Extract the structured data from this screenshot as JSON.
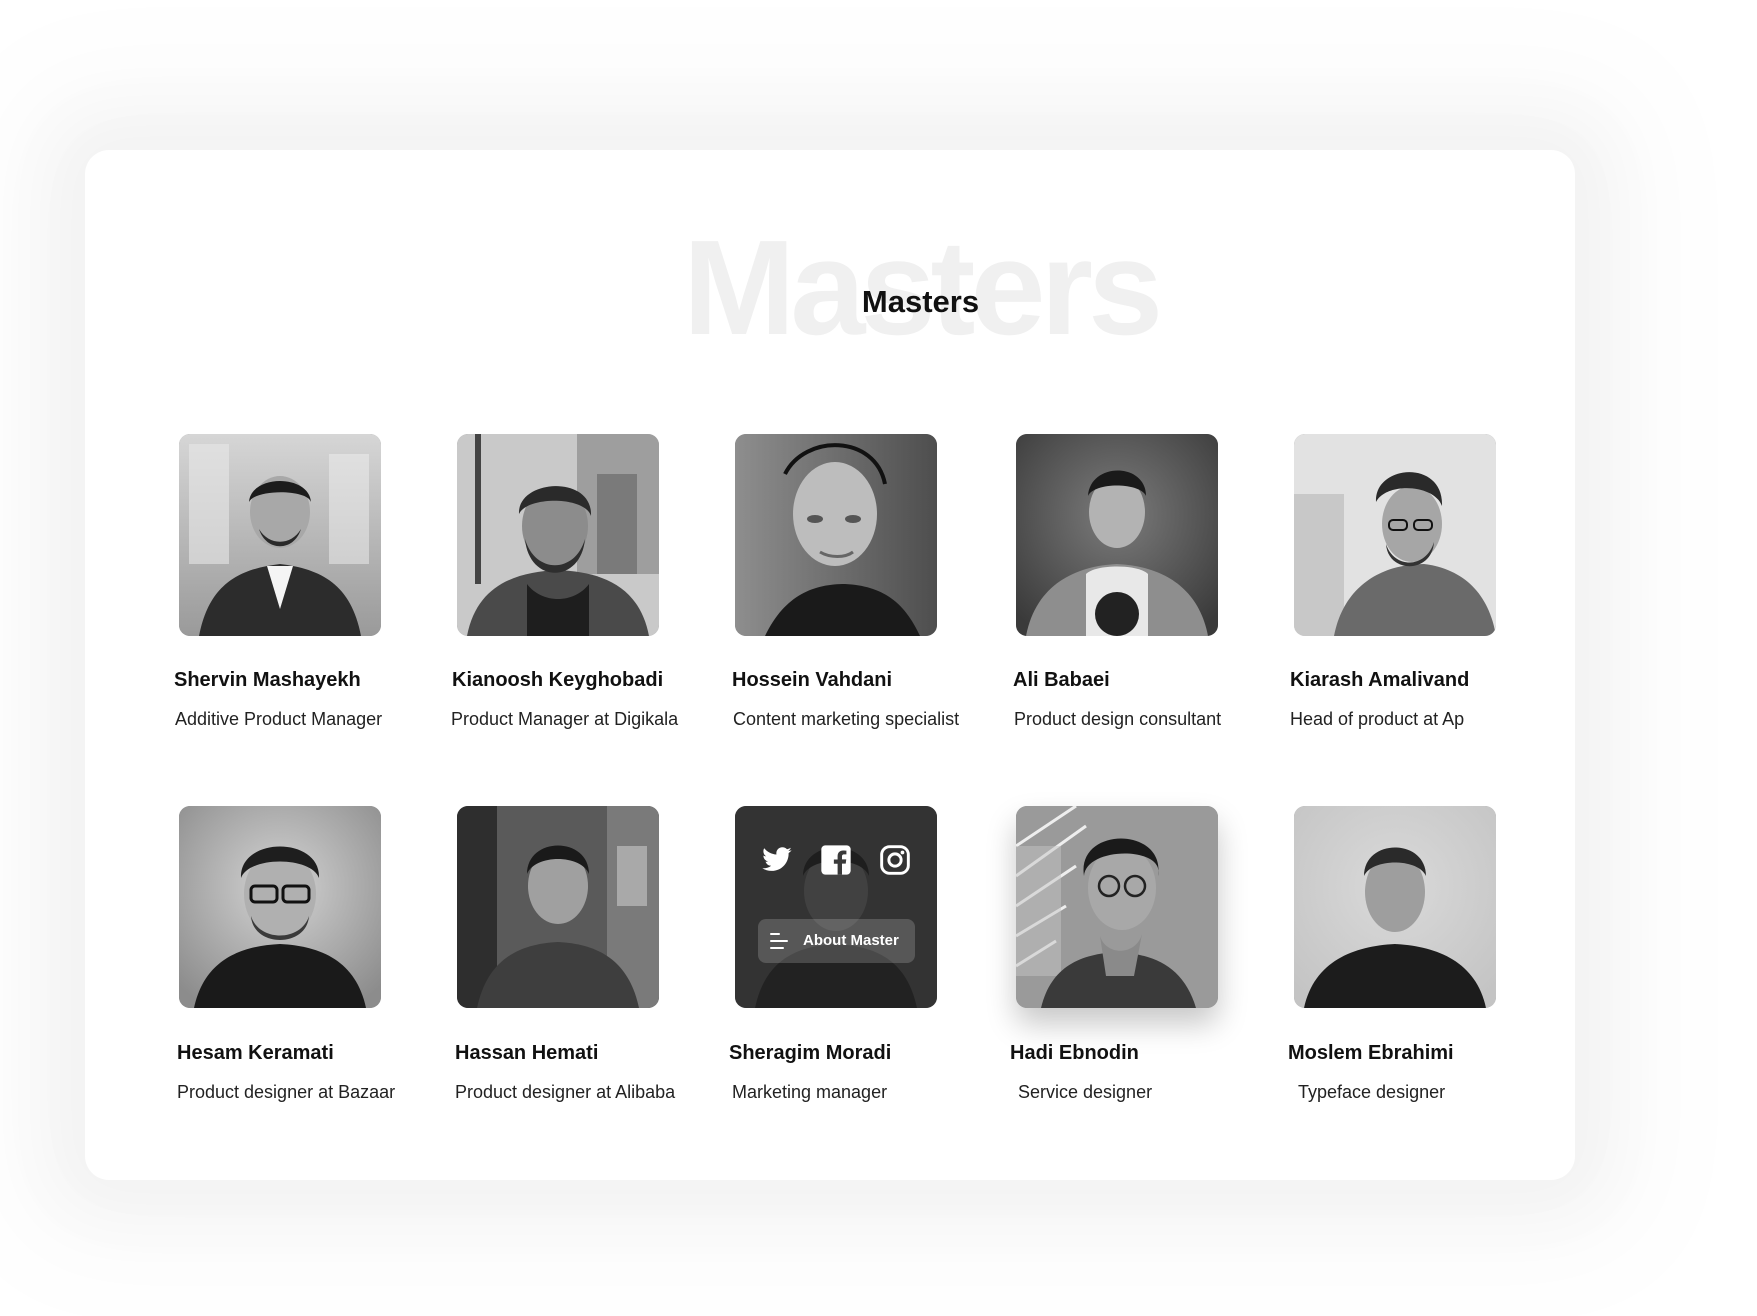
{
  "section": {
    "background_word": "Masters",
    "title": "Masters"
  },
  "masters": [
    {
      "name": "Shervin Mashayekh",
      "role": "Additive Product Manager"
    },
    {
      "name": "Kianoosh Keyghobadi",
      "role": "Product Manager at Digikala"
    },
    {
      "name": "Hossein Vahdani",
      "role": "Content marketing specialist"
    },
    {
      "name": "Ali Babaei",
      "role": "Product design consultant"
    },
    {
      "name": "Kiarash Amalivand",
      "role": "Head of product at Ap"
    },
    {
      "name": "Hesam Keramati",
      "role": "Product designer at Bazaar"
    },
    {
      "name": "Hassan Hemati",
      "role": "Product designer at Alibaba"
    },
    {
      "name": "Sheragim Moradi",
      "role": "Marketing manager"
    },
    {
      "name": "Hadi Ebnodin",
      "role": "Service designer"
    },
    {
      "name": "Moslem Ebrahimi",
      "role": "Typeface designer"
    }
  ],
  "hover_card": {
    "about_label": "About Master",
    "social_icons": [
      "twitter-icon",
      "facebook-icon",
      "instagram-icon"
    ],
    "menu_icon": "menu-lines-icon"
  },
  "colors": {
    "text": "#111111",
    "background_word": "#f0f0f0",
    "overlay": "#1e1e1e"
  }
}
